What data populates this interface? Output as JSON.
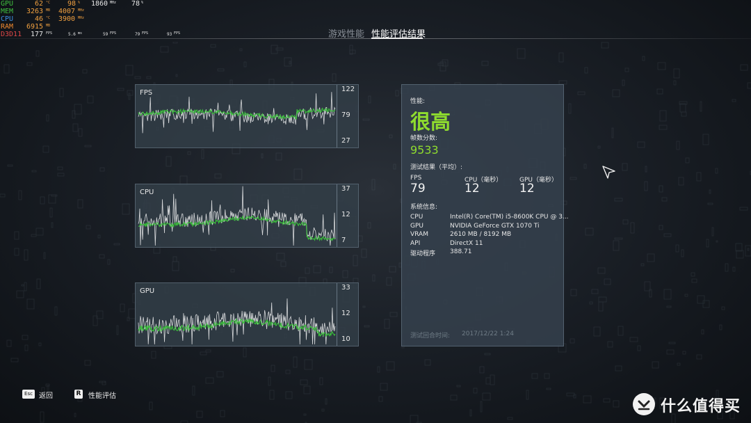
{
  "osd": {
    "rows": [
      {
        "label": "GPU",
        "v1": "62",
        "u1": "°C",
        "v2": "98",
        "u2": "%",
        "v3": "1860",
        "u3": "MHz",
        "v4": "78",
        "u4": "%"
      },
      {
        "label": "MEM",
        "v1": "3263",
        "u1": "MB",
        "v2": "4007",
        "u2": "MHz"
      },
      {
        "label": "CPU",
        "v1": "46",
        "u1": "°C",
        "v2": "3900",
        "u2": "MHz"
      },
      {
        "label": "RAM",
        "v1": "6915",
        "u1": "MB"
      },
      {
        "label": "D3D11",
        "v1": "177",
        "u1": "FPS",
        "v2": "5.6",
        "u2": "ms",
        "v3": "59",
        "u3": "FPS",
        "v4": "79",
        "u4": "FPS",
        "v5": "93",
        "u5": "FPS"
      }
    ]
  },
  "tabs": {
    "game": "游戏性能",
    "result": "性能评估结果"
  },
  "graphs": {
    "fps": {
      "title": "FPS",
      "ticks": [
        "122",
        "79",
        "27"
      ]
    },
    "cpu": {
      "title": "CPU",
      "ticks": [
        "37",
        "12",
        "7"
      ]
    },
    "gpu": {
      "title": "GPU",
      "ticks": [
        "33",
        "12",
        "10"
      ]
    }
  },
  "results": {
    "perf_label": "性能:",
    "perf_rating": "很高",
    "score_label": "帧数分数:",
    "score": "9533",
    "avg_label": "测试结果（平均）:",
    "fps_label": "FPS",
    "fps_value": "79",
    "cpu_label": "CPU（毫秒）",
    "cpu_value": "12",
    "gpu_label": "GPU（毫秒）",
    "gpu_value": "12",
    "sys_label": "系统信息:",
    "sys": [
      {
        "k": "CPU",
        "v": "Intel(R) Core(TM) i5-8600K CPU @ 3..."
      },
      {
        "k": "GPU",
        "v": "NVIDIA GeForce GTX 1070 Ti"
      },
      {
        "k": "VRAM",
        "v": "2610 MB / 8192 MB"
      },
      {
        "k": "API",
        "v": "DirectX 11"
      },
      {
        "k": "驱动程序",
        "v": "388.71"
      }
    ],
    "date_label": "测试回合时间:",
    "date_value": "2017/12/22 1:24"
  },
  "hints": {
    "esc_key": "Esc",
    "esc_label": "返回",
    "r_key": "R",
    "r_label": "性能评估"
  },
  "watermark": "什么值得买",
  "colors": {
    "accent_green": "#8fdc2e",
    "line_white": "#d8dadc",
    "line_green": "#3cc23c"
  }
}
